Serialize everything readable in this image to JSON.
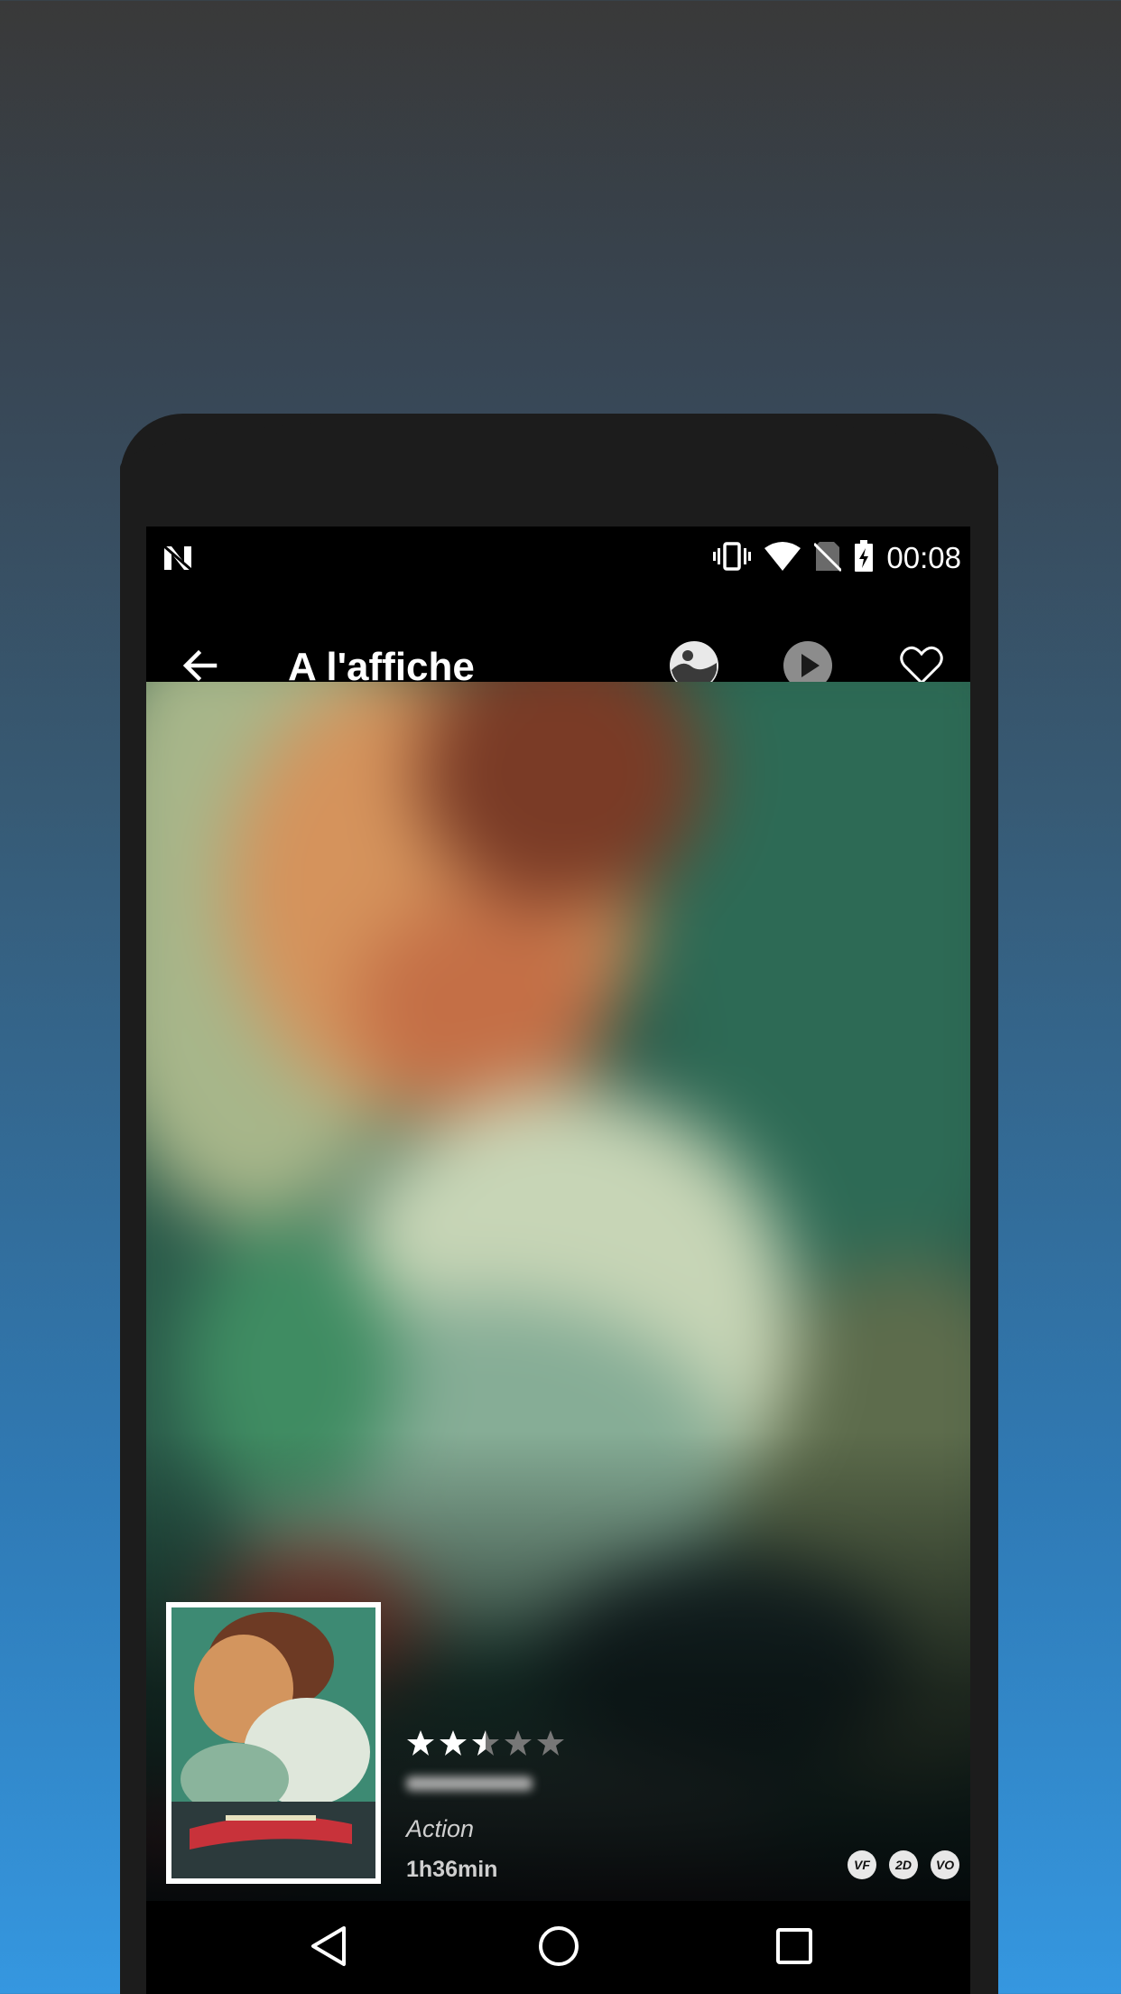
{
  "status_bar": {
    "time": "00:08",
    "icons": [
      "notification-n-icon",
      "vibrate-icon",
      "wifi-icon",
      "no-sim-icon",
      "battery-icon"
    ]
  },
  "toolbar": {
    "title": "A l'affiche",
    "icons": [
      "back-arrow-icon",
      "gallery-icon",
      "play-icon",
      "favorite-heart-icon"
    ]
  },
  "movie": {
    "rating_stars": 2.5,
    "rating_max": 5,
    "genre": "Action",
    "duration": "1h36min",
    "badges": [
      "VF",
      "2D",
      "VO"
    ]
  },
  "nav_bar": {
    "icons": [
      "nav-back-icon",
      "nav-home-icon",
      "nav-recents-icon"
    ]
  },
  "colors": {
    "background_top": "#393939",
    "background_bottom": "#3597e0",
    "phone_body": "#1c1c1c",
    "toolbar": "#000000"
  }
}
